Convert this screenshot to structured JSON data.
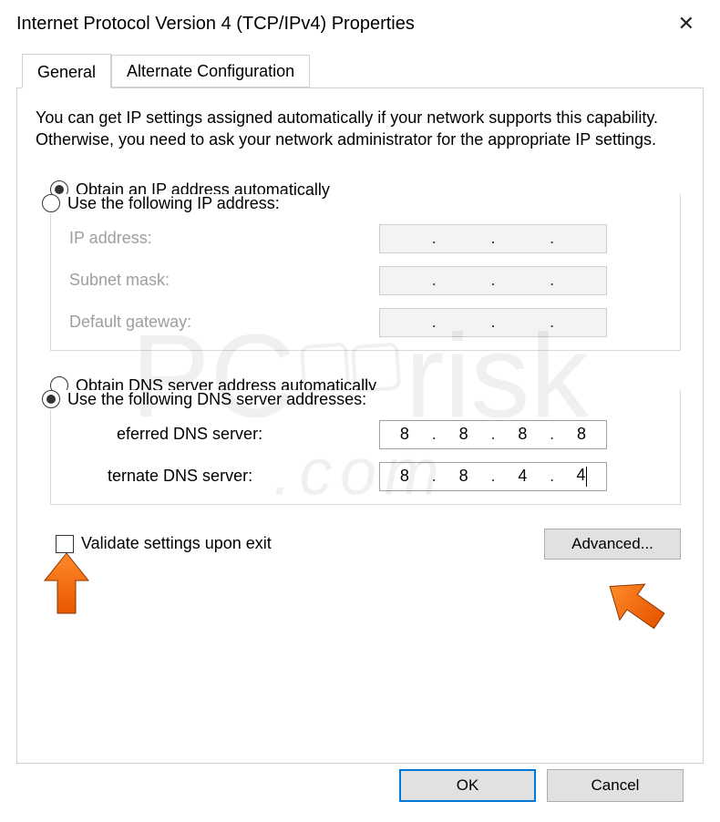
{
  "window": {
    "title": "Internet Protocol Version 4 (TCP/IPv4) Properties"
  },
  "tabs": {
    "general": "General",
    "alternate": "Alternate Configuration"
  },
  "intro": "You can get IP settings assigned automatically if your network supports this capability. Otherwise, you need to ask your network administrator for the appropriate IP settings.",
  "ip_section": {
    "obtain_auto": "Obtain an IP address automatically",
    "use_following": "Use the following IP address:",
    "ip_address_label": "IP address:",
    "subnet_label": "Subnet mask:",
    "gateway_label": "Default gateway:"
  },
  "dns_section": {
    "obtain_auto": "Obtain DNS server address automatically",
    "use_following": "Use the following DNS server addresses:",
    "preferred_label": "Preferred DNS server:",
    "alternate_label": "Alternate DNS server:",
    "preferred": {
      "o1": "8",
      "o2": "8",
      "o3": "8",
      "o4": "8"
    },
    "alternate": {
      "o1": "8",
      "o2": "8",
      "o3": "4",
      "o4": "4"
    }
  },
  "validate_label": "Validate settings upon exit",
  "advanced_label": "Advanced...",
  "ok_label": "OK",
  "cancel_label": "Cancel",
  "watermark": {
    "brand1": "PC",
    "brand2": "risk",
    "url": ".com"
  }
}
